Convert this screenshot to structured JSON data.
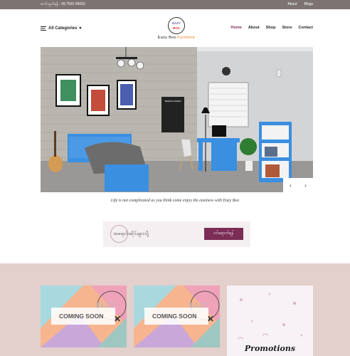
{
  "topbar": {
    "phone": "ဆက်သွယ်ရန် - 09 7591 00010",
    "links": [
      "About",
      "Blogs"
    ]
  },
  "header": {
    "categories_label": "All Categories",
    "logo_top": "EAZY",
    "logo_bottom": "BOX",
    "brand_main": "Eazy Box",
    "brand_sub": "Furniture",
    "nav": [
      {
        "label": "Home",
        "active": true
      },
      {
        "label": "About",
        "active": false
      },
      {
        "label": "Shop",
        "active": false
      },
      {
        "label": "Store",
        "active": false
      },
      {
        "label": "Contact",
        "active": false
      }
    ]
  },
  "hero": {
    "prev": "‹",
    "next": "›",
    "board_title": "WEEKPLANNER"
  },
  "tagline": "Life is not complicated as you think come enjoy the easiness with Eazy Box",
  "promo_banner": {
    "text": "အရောင်းဆိုင်များသို့",
    "button": "ဝင်ရောက်ရန်"
  },
  "cards": [
    {
      "label": "COMING SOON",
      "close": "✕",
      "logo": "EAZY"
    },
    {
      "label": "COMING SOON",
      "close": "✕",
      "logo": "EAZY"
    }
  ],
  "promotions": {
    "title": "Promotions"
  },
  "colors": {
    "topbar": "#7d7472",
    "accent": "#7b2d56",
    "nav_active": "#8b2a5d",
    "section_bg": "#e3cfcb",
    "brand_orange": "#e2791f",
    "furniture_blue": "#3a8fe0"
  }
}
